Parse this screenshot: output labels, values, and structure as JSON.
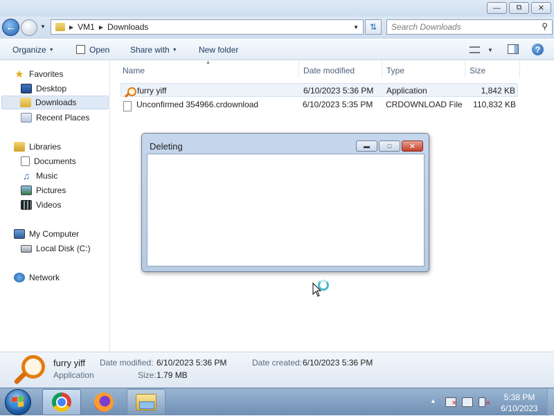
{
  "window": {
    "minimize_icon": "minimize-icon",
    "maximize_icon": "maximize-icon",
    "close_icon": "close-icon"
  },
  "address": {
    "crumbs": [
      "VM1",
      "Downloads"
    ],
    "search_placeholder": "Search Downloads"
  },
  "toolbar": {
    "organize": "Organize",
    "open": "Open",
    "share_with": "Share with",
    "new_folder": "New folder"
  },
  "navpane": {
    "favorites": "Favorites",
    "desktop": "Desktop",
    "downloads": "Downloads",
    "recent_places": "Recent Places",
    "libraries": "Libraries",
    "documents": "Documents",
    "music": "Music",
    "pictures": "Pictures",
    "videos": "Videos",
    "my_computer": "My Computer",
    "local_disk": "Local Disk (C:)",
    "network": "Network"
  },
  "filelist": {
    "columns": [
      "Name",
      "Date modified",
      "Type",
      "Size"
    ],
    "rows": [
      {
        "name": "furry yiff",
        "date": "6/10/2023 5:36 PM",
        "type": "Application",
        "size": "1,842 KB"
      },
      {
        "name": "Unconfirmed 354966.crdownload",
        "date": "6/10/2023 5:35 PM",
        "type": "CRDOWNLOAD File",
        "size": "110,832 KB"
      }
    ]
  },
  "dialog": {
    "title": "Deleting"
  },
  "details": {
    "name": "furry yiff",
    "kind": "Application",
    "date_modified_label": "Date modified:",
    "date_modified": "6/10/2023 5:36 PM",
    "size_label": "Size:",
    "size": "1.79 MB",
    "date_created_label": "Date created:",
    "date_created": "6/10/2023 5:36 PM"
  },
  "taskbar": {
    "time": "5:38 PM",
    "date": "6/10/2023"
  },
  "colors": {
    "accent": "#1e395b",
    "close_red": "#c4402a",
    "selection": "#dfe9f6"
  }
}
